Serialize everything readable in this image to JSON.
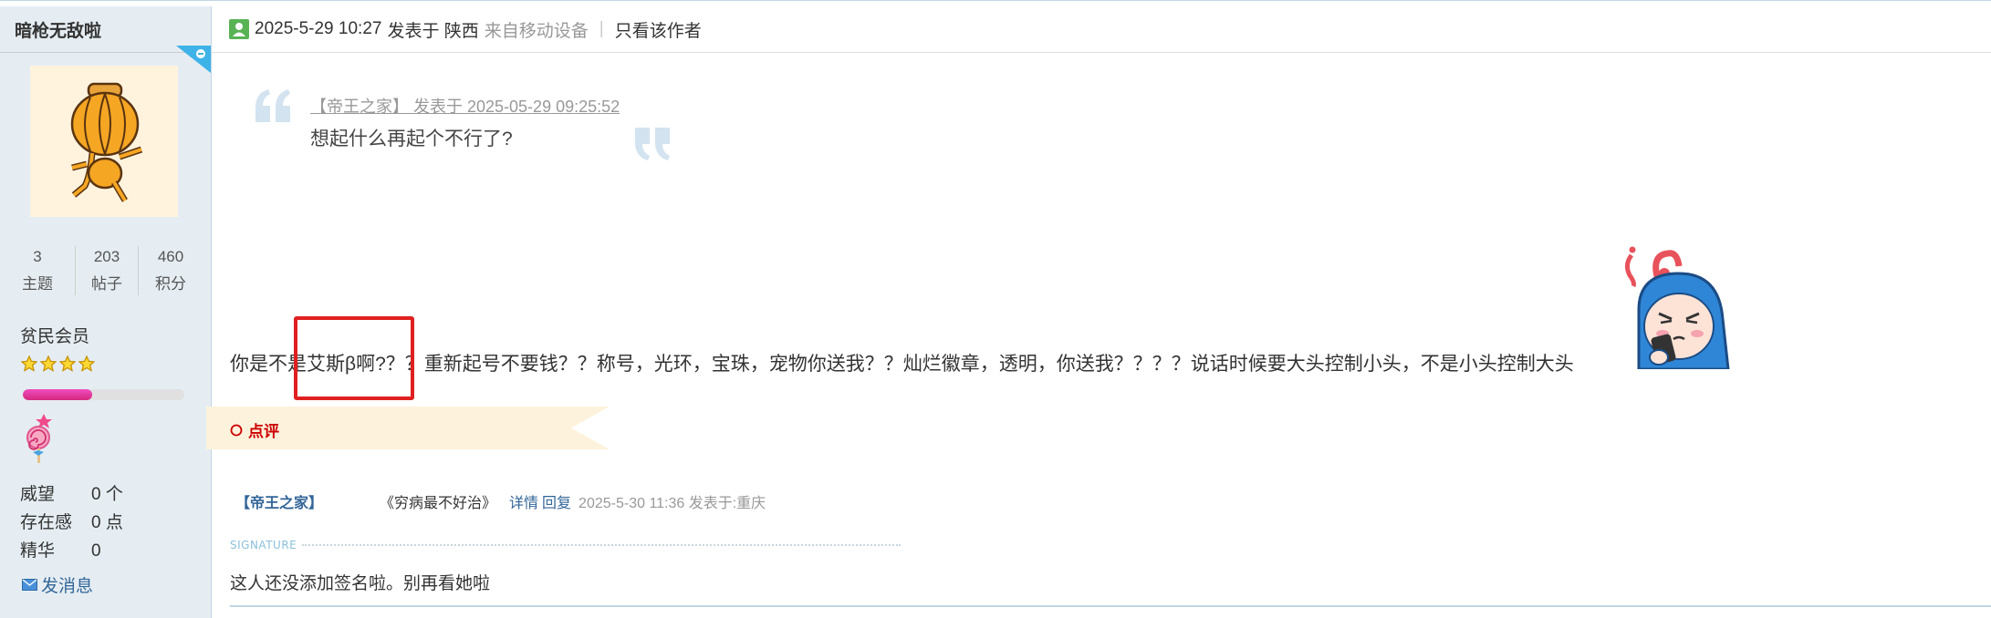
{
  "user": {
    "username": "暗枪无敌啦",
    "stats": [
      {
        "value": "3",
        "label": "主题"
      },
      {
        "value": "203",
        "label": "帖子"
      },
      {
        "value": "460",
        "label": "积分"
      }
    ],
    "rank": "贫民会员",
    "star_count": 4,
    "credit_progress": 0.43,
    "info": [
      {
        "key": "威望",
        "value": "0 个"
      },
      {
        "key": "存在感",
        "value": "0 点"
      },
      {
        "key": "精华",
        "value": "0"
      }
    ],
    "send_message": "发消息"
  },
  "post": {
    "timestamp": "2025-5-29 10:27",
    "posted_at_label": "发表于 陕西",
    "device": "来自移动设备",
    "separator": "|",
    "only_author": "只看该作者",
    "quote": {
      "meta": "【帝王之家】 发表于 2025-05-29 09:25:52",
      "text": "想起什么再起个不行了?"
    },
    "body": "你是不是艾斯β啊?？？重新起号不要钱？？称号，光环，宝珠，宠物你送我？？灿烂徽章，透明，你送我？？？？说话时候要大头控制小头，不是小头控制大头",
    "comment_section_label": "点评",
    "comment": {
      "user": "【帝王之家】",
      "text": "《穷病最不好治》",
      "detail": "详情",
      "reply": "回复",
      "time": "2025-5-30 11:36 发表于:重庆"
    },
    "signature_label": "SIGNATURE",
    "signature": "这人还没添加签名啦。别再看她啦"
  },
  "colors": {
    "sidebar_bg": "#e5edf2",
    "link": "#336699",
    "highlight": "#e02020",
    "comment_red": "#cc0000"
  }
}
